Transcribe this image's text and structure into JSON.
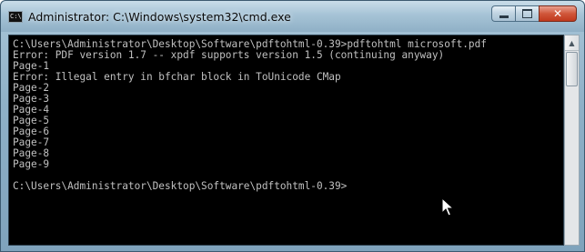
{
  "window": {
    "title": "Administrator: C:\\Windows\\system32\\cmd.exe",
    "icon": "cmd-icon",
    "icon_text": "C:\\",
    "controls": {
      "minimize": "minimize-icon",
      "maximize": "maximize-icon",
      "close": "close-icon",
      "close_glyph": "✕"
    }
  },
  "console": {
    "background": "#000000",
    "foreground": "#c0c0c0",
    "lines": [
      "C:\\Users\\Administrator\\Desktop\\Software\\pdftohtml-0.39>pdftohtml microsoft.pdf",
      "Error: PDF version 1.7 -- xpdf supports version 1.5 (continuing anyway)",
      "Page-1",
      "Error: Illegal entry in bfchar block in ToUnicode CMap",
      "Page-2",
      "Page-3",
      "Page-4",
      "Page-5",
      "Page-6",
      "Page-7",
      "Page-8",
      "Page-9",
      "",
      "C:\\Users\\Administrator\\Desktop\\Software\\pdftohtml-0.39>"
    ]
  },
  "scrollbar": {
    "up_arrow": "▲"
  },
  "pointer": "mouse-pointer-icon"
}
